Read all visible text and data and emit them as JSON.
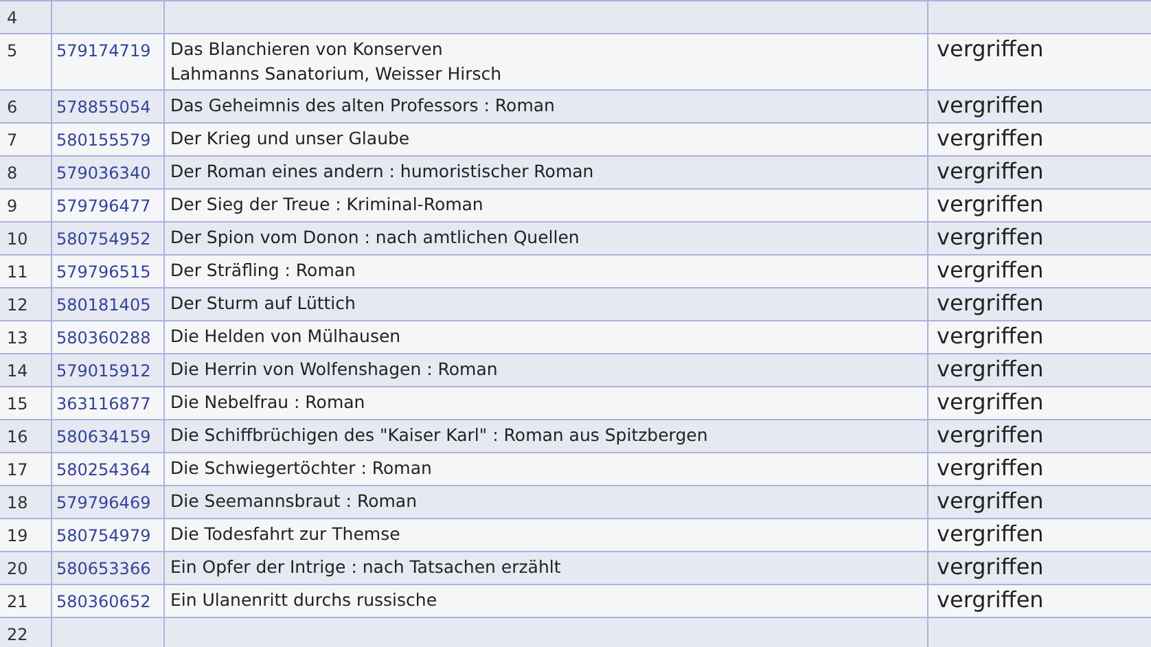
{
  "table": {
    "rows": [
      {
        "number": "4"
      },
      {
        "number": "5",
        "id": "579174719",
        "title": "Das Blanchieren von Konserven",
        "subtitle": "Lahmanns Sanatorium, Weisser Hirsch",
        "status": "vergriffen"
      },
      {
        "number": "6",
        "id": "578855054",
        "title": "Das Geheimnis des alten Professors : Roman",
        "status": "vergriffen"
      },
      {
        "number": "7",
        "id": "580155579",
        "title": "Der Krieg und unser Glaube",
        "status": "vergriffen"
      },
      {
        "number": "8",
        "id": "579036340",
        "title": "Der Roman eines andern : humoristischer Roman",
        "status": "vergriffen"
      },
      {
        "number": "9",
        "id": "579796477",
        "title": "Der Sieg der Treue : Kriminal-Roman",
        "status": "vergriffen"
      },
      {
        "number": "10",
        "id": "580754952",
        "title": "Der Spion vom Donon : nach amtlichen Quellen",
        "status": "vergriffen"
      },
      {
        "number": "11",
        "id": "579796515",
        "title": "Der Sträfling : Roman",
        "status": "vergriffen"
      },
      {
        "number": "12",
        "id": "580181405",
        "title": "Der Sturm auf Lüttich",
        "status": "vergriffen"
      },
      {
        "number": "13",
        "id": "580360288",
        "title": "Die Helden von Mülhausen",
        "status": "vergriffen"
      },
      {
        "number": "14",
        "id": "579015912",
        "title": "Die Herrin von Wolfenshagen : Roman",
        "status": "vergriffen"
      },
      {
        "number": "15",
        "id": "363116877",
        "title": "Die Nebelfrau : Roman",
        "status": "vergriffen"
      },
      {
        "number": "16",
        "id": "580634159",
        "title": "Die Schiffbrüchigen des \"Kaiser Karl\" : Roman aus Spitzbergen",
        "status": "vergriffen"
      },
      {
        "number": "17",
        "id": "580254364",
        "title": "Die Schwiegertöchter : Roman",
        "status": "vergriffen"
      },
      {
        "number": "18",
        "id": "579796469",
        "title": "Die Seemannsbraut : Roman",
        "status": "vergriffen"
      },
      {
        "number": "19",
        "id": "580754979",
        "title": "Die Todesfahrt zur Themse",
        "status": "vergriffen"
      },
      {
        "number": "20",
        "id": "580653366",
        "title": "Ein Opfer der Intrige : nach Tatsachen erzählt",
        "status": "vergriffen"
      },
      {
        "number": "21",
        "id": "580360652",
        "title": "Ein Ulanenritt durchs russische",
        "status": "vergriffen"
      },
      {
        "number": "22"
      }
    ]
  }
}
